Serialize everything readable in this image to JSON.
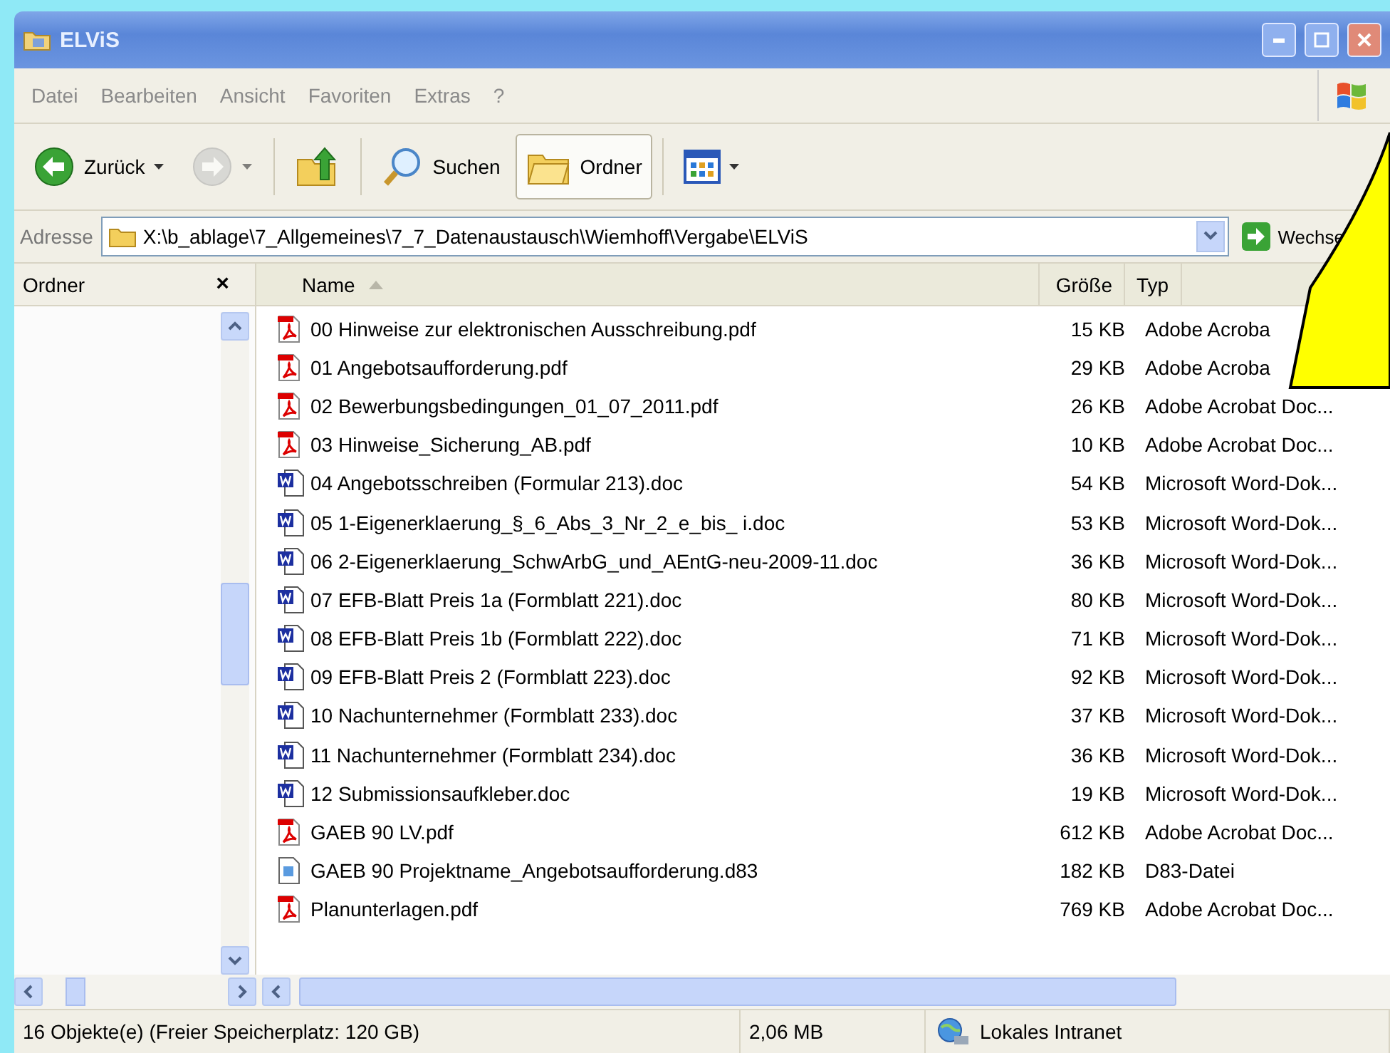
{
  "window": {
    "title": "ELViS"
  },
  "menu": [
    "Datei",
    "Bearbeiten",
    "Ansicht",
    "Favoriten",
    "Extras",
    "?"
  ],
  "toolbar": [
    {
      "kind": "back",
      "label": "Zurück",
      "disabled": false,
      "selected": false
    },
    {
      "kind": "forward",
      "disabled": true,
      "selected": false
    },
    {
      "kind": "up",
      "disabled": false,
      "selected": false
    },
    {
      "kind": "search",
      "label": "Suchen",
      "disabled": false,
      "selected": false
    },
    {
      "kind": "folders",
      "label": "Ordner",
      "disabled": false,
      "selected": true
    },
    {
      "kind": "views",
      "disabled": false,
      "selected": false
    }
  ],
  "address": {
    "label": "Adresse",
    "value": "X:\\b_ablage\\7_Allgemeines\\7_7_Datenaustausch\\Wiemhoff\\Vergabe\\ELViS",
    "go_label": "Wechse"
  },
  "folder_pane": {
    "title": "Ordner",
    "close": "×"
  },
  "columns": [
    {
      "label": "Name",
      "sorted": true
    },
    {
      "label": "Größe",
      "sorted": false
    },
    {
      "label": "Typ",
      "sorted": false
    }
  ],
  "rows": [
    {
      "kind": "pdf",
      "name": "00 Hinweise zur elektronischen Ausschreibung.pdf",
      "size": "15 KB",
      "type": "Adobe Acroba"
    },
    {
      "kind": "pdf",
      "name": "01 Angebotsaufforderung.pdf",
      "size": "29 KB",
      "type": "Adobe Acroba"
    },
    {
      "kind": "pdf",
      "name": "02 Bewerbungsbedingungen_01_07_2011.pdf",
      "size": "26 KB",
      "type": "Adobe Acrobat Doc..."
    },
    {
      "kind": "pdf",
      "name": "03 Hinweise_Sicherung_AB.pdf",
      "size": "10 KB",
      "type": "Adobe Acrobat Doc..."
    },
    {
      "kind": "word",
      "name": "04 Angebotsschreiben (Formular 213).doc",
      "size": "54 KB",
      "type": "Microsoft Word-Dok..."
    },
    {
      "kind": "word",
      "name": "05 1-Eigenerklaerung_§_6_Abs_3_Nr_2_e_bis_ i.doc",
      "size": "53 KB",
      "type": "Microsoft Word-Dok..."
    },
    {
      "kind": "word",
      "name": "06 2-Eigenerklaerung_SchwArbG_und_AEntG-neu-2009-11.doc",
      "size": "36 KB",
      "type": "Microsoft Word-Dok..."
    },
    {
      "kind": "word",
      "name": "07 EFB-Blatt  Preis 1a (Formblatt 221).doc",
      "size": "80 KB",
      "type": "Microsoft Word-Dok..."
    },
    {
      "kind": "word",
      "name": "08 EFB-Blatt  Preis 1b (Formblatt 222).doc",
      "size": "71 KB",
      "type": "Microsoft Word-Dok..."
    },
    {
      "kind": "word",
      "name": "09 EFB-Blatt  Preis 2 (Formblatt 223).doc",
      "size": "92 KB",
      "type": "Microsoft Word-Dok..."
    },
    {
      "kind": "word",
      "name": "10 Nachunternehmer (Formblatt 233).doc",
      "size": "37 KB",
      "type": "Microsoft Word-Dok..."
    },
    {
      "kind": "word",
      "name": "11 Nachunternehmer (Formblatt 234).doc",
      "size": "36 KB",
      "type": "Microsoft Word-Dok..."
    },
    {
      "kind": "word",
      "name": "12 Submissionsaufkleber.doc",
      "size": "19 KB",
      "type": "Microsoft Word-Dok..."
    },
    {
      "kind": "pdf",
      "name": "GAEB 90 LV.pdf",
      "size": "612 KB",
      "type": "Adobe Acrobat Doc..."
    },
    {
      "kind": "file",
      "name": "GAEB 90 Projektname_Angebotsaufforderung.d83",
      "size": "182 KB",
      "type": "D83-Datei"
    },
    {
      "kind": "pdf",
      "name": "Planunterlagen.pdf",
      "size": "769 KB",
      "type": "Adobe Acrobat Doc..."
    }
  ],
  "status_bar": {
    "objects": "16 Objekte(e) (Freier Speicherplatz: 120 GB)",
    "size": "2,06 MB",
    "zone": "Lokales Intranet"
  }
}
